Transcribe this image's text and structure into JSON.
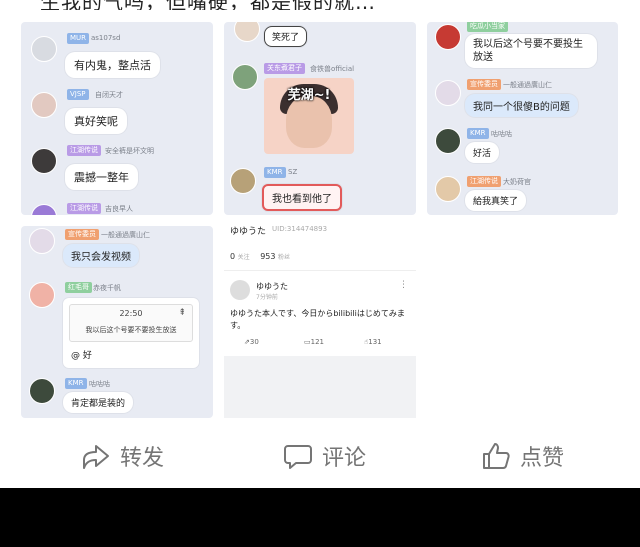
{
  "top_text": "生我的气吗，但嘴硬，都是假的就…",
  "cards": {
    "c1": {
      "messages": [
        {
          "badge": "MUR",
          "user": "as107sd",
          "text": "有内鬼，整点活"
        },
        {
          "badge": "VJSP",
          "user": "自闭天才",
          "text": "真好笑呢"
        },
        {
          "badge": "江湖传说",
          "user": "安全裤是坏文明",
          "text": "震撼一整年"
        },
        {
          "badge": "江湖传说",
          "user": "吉良早人"
        }
      ]
    },
    "c2": {
      "messages": [
        {
          "text": "笑死了"
        },
        {
          "badge": "关东煮君子",
          "user": "食铁兽official",
          "sticker_caption": "芜湖~!"
        },
        {
          "badge": "KMR",
          "user": "SZ",
          "text": "我也看到他了"
        }
      ]
    },
    "c3": {
      "messages": [
        {
          "badge": "吃瓜小当家",
          "text": "我以后这个号要不要投生放送"
        },
        {
          "badge": "宣传委员",
          "user": "一般通過廣山仁",
          "text": "我同一个很傻B的问题"
        },
        {
          "badge": "KMR",
          "user": "咕咕咕",
          "text": "好活"
        },
        {
          "badge": "江湖传说",
          "user": "大奶荷官",
          "text": "給我真笑了"
        }
      ]
    },
    "c4": {
      "messages": [
        {
          "badge": "宣传委员",
          "user": "一般通過廣山仁",
          "text": "我只会发视频"
        },
        {
          "badge": "红毛哥",
          "user": "赤夜千帆",
          "reply_time": "22:50",
          "reply_quote": "我以后这个号要不要投生放送",
          "text": "@    好"
        },
        {
          "badge": "KMR",
          "user": "咕咕咕",
          "text": "肯定都是装的"
        }
      ]
    }
  },
  "profile": {
    "name": "ゆゆうた",
    "uid": "UID:314474893",
    "following": "0",
    "following_label": "关注",
    "followers": "953",
    "followers_label": "粉丝",
    "post_name": "ゆゆうた",
    "post_time": "7分钟前",
    "post_text": "ゆゆうた本人です、今日からbilibiliはじめてみます。",
    "shares": "30",
    "comments": "121",
    "likes": "131"
  },
  "bottom_actions": {
    "share": "转发",
    "comment": "评论",
    "like": "点赞"
  }
}
